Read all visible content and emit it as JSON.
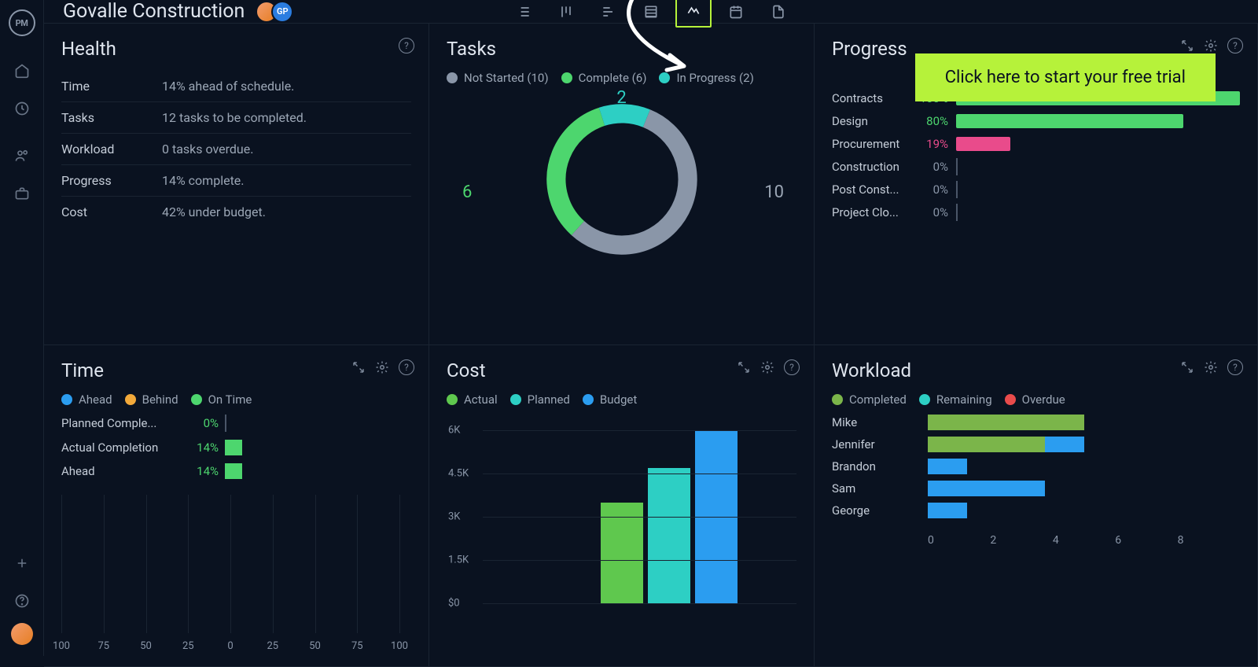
{
  "project_title": "Govalle Construction",
  "avatar_label": "GP",
  "cta_text": "Click here to start your free trial",
  "health": {
    "title": "Health",
    "rows": [
      {
        "label": "Time",
        "value": "14% ahead of schedule."
      },
      {
        "label": "Tasks",
        "value": "12 tasks to be completed."
      },
      {
        "label": "Workload",
        "value": "0 tasks overdue."
      },
      {
        "label": "Progress",
        "value": "14% complete."
      },
      {
        "label": "Cost",
        "value": "42% under budget."
      }
    ]
  },
  "tasks": {
    "title": "Tasks",
    "legend": [
      {
        "label": "Not Started (10)",
        "color": "#8a96a8"
      },
      {
        "label": "Complete (6)",
        "color": "#4dd66e"
      },
      {
        "label": "In Progress (2)",
        "color": "#2dcfc4"
      }
    ],
    "donut_labels": {
      "top": "2",
      "left": "6",
      "right": "10"
    }
  },
  "progress": {
    "title": "Progress",
    "rows": [
      {
        "name": "Contracts",
        "pct": "100%",
        "pct_num": 100,
        "color": "#4dd66e",
        "pct_color": "#4dd66e"
      },
      {
        "name": "Design",
        "pct": "80%",
        "pct_num": 80,
        "color": "#4dd66e",
        "pct_color": "#4dd66e"
      },
      {
        "name": "Procurement",
        "pct": "19%",
        "pct_num": 19,
        "color": "#e94b8b",
        "pct_color": "#e94b8b"
      },
      {
        "name": "Construction",
        "pct": "0%",
        "pct_num": 0,
        "color": "#4a5668",
        "pct_color": "#8a96a8"
      },
      {
        "name": "Post Const...",
        "pct": "0%",
        "pct_num": 0,
        "color": "#4a5668",
        "pct_color": "#8a96a8"
      },
      {
        "name": "Project Clo...",
        "pct": "0%",
        "pct_num": 0,
        "color": "#4a5668",
        "pct_color": "#8a96a8"
      }
    ]
  },
  "time": {
    "title": "Time",
    "legend": [
      {
        "label": "Ahead",
        "color": "#2b9df0"
      },
      {
        "label": "Behind",
        "color": "#f2a93a"
      },
      {
        "label": "On Time",
        "color": "#4dd66e"
      }
    ],
    "rows": [
      {
        "name": "Planned Comple...",
        "pct": "0%",
        "bar": 0
      },
      {
        "name": "Actual Completion",
        "pct": "14%",
        "bar": 1
      },
      {
        "name": "Ahead",
        "pct": "14%",
        "bar": 1
      }
    ],
    "axis": [
      "100",
      "75",
      "50",
      "25",
      "0",
      "25",
      "50",
      "75",
      "100"
    ]
  },
  "cost": {
    "title": "Cost",
    "legend": [
      {
        "label": "Actual",
        "color": "#5fc84e"
      },
      {
        "label": "Planned",
        "color": "#2dcfc4"
      },
      {
        "label": "Budget",
        "color": "#2b9df0"
      }
    ],
    "yticks": [
      "6K",
      "4.5K",
      "3K",
      "1.5K",
      "$0"
    ]
  },
  "workload": {
    "title": "Workload",
    "legend": [
      {
        "label": "Completed",
        "color": "#7bb54a"
      },
      {
        "label": "Remaining",
        "color": "#2dcfc4"
      },
      {
        "label": "Overdue",
        "color": "#e94b4b"
      }
    ],
    "rows": [
      {
        "name": "Mike"
      },
      {
        "name": "Jennifer"
      },
      {
        "name": "Brandon"
      },
      {
        "name": "Sam"
      },
      {
        "name": "George"
      }
    ],
    "axis": [
      "0",
      "2",
      "4",
      "6",
      "8"
    ]
  },
  "chart_data": [
    {
      "type": "pie",
      "title": "Tasks",
      "series": [
        {
          "name": "Not Started",
          "value": 10
        },
        {
          "name": "Complete",
          "value": 6
        },
        {
          "name": "In Progress",
          "value": 2
        }
      ]
    },
    {
      "type": "bar",
      "title": "Progress",
      "categories": [
        "Contracts",
        "Design",
        "Procurement",
        "Construction",
        "Post Construction",
        "Project Closure"
      ],
      "values": [
        100,
        80,
        19,
        0,
        0,
        0
      ],
      "xlabel": "",
      "ylabel": "%",
      "ylim": [
        0,
        100
      ]
    },
    {
      "type": "bar",
      "title": "Time",
      "categories": [
        "Planned Completion",
        "Actual Completion",
        "Ahead"
      ],
      "values": [
        0,
        14,
        14
      ],
      "xlabel": "",
      "ylabel": "%",
      "ylim": [
        -100,
        100
      ]
    },
    {
      "type": "bar",
      "title": "Cost",
      "categories": [
        "Actual",
        "Planned",
        "Budget"
      ],
      "values": [
        3500,
        4700,
        6000
      ],
      "xlabel": "",
      "ylabel": "$",
      "ylim": [
        0,
        6000
      ]
    },
    {
      "type": "bar",
      "title": "Workload",
      "categories": [
        "Mike",
        "Jennifer",
        "Brandon",
        "Sam",
        "George"
      ],
      "series": [
        {
          "name": "Completed",
          "values": [
            4,
            3,
            0,
            0,
            0
          ]
        },
        {
          "name": "Remaining",
          "values": [
            0,
            1,
            1,
            3,
            1
          ]
        },
        {
          "name": "Overdue",
          "values": [
            0,
            0,
            0,
            0,
            0
          ]
        }
      ],
      "xlim": [
        0,
        8
      ]
    }
  ]
}
